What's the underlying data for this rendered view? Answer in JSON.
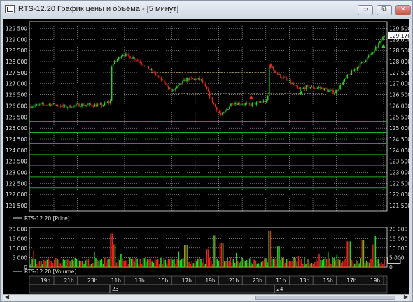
{
  "window": {
    "title": "RTS-12.20 График цены и объёма - [5 минут]",
    "controls": {
      "minimize": "▭",
      "restore": "⧉",
      "close": "✕"
    },
    "icon": "chart-window-icon"
  },
  "colors": {
    "background": "#000000",
    "grid": "#ffffff",
    "candle_up": "#1fd81f",
    "candle_down": "#e8231f",
    "level_line": "#22b022",
    "level_line_dashed": "#c41e1e",
    "price_label_bg": "#ffffff"
  },
  "chart_data": [
    {
      "type": "candlestick",
      "legend": "RTS-12.20 [Price]",
      "current_price_label": "129 170",
      "y_ticks": [
        "129 500",
        "129 000",
        "128 500",
        "128 000",
        "127 500",
        "127 000",
        "126 500",
        "126 000",
        "125 500",
        "125 000",
        "124 500",
        "124 000",
        "123 500",
        "123 000",
        "122 500",
        "122 000",
        "121 500"
      ],
      "ylim": [
        121250,
        129800
      ],
      "close_path": [
        [
          0,
          126000
        ],
        [
          0.06,
          126080
        ],
        [
          0.1,
          125950
        ],
        [
          0.14,
          126050
        ],
        [
          0.2,
          126020
        ],
        [
          0.225,
          126200
        ],
        [
          0.228,
          127800
        ],
        [
          0.26,
          128350
        ],
        [
          0.3,
          128100
        ],
        [
          0.34,
          127600
        ],
        [
          0.38,
          127000
        ],
        [
          0.4,
          126650
        ],
        [
          0.44,
          127200
        ],
        [
          0.48,
          127200
        ],
        [
          0.5,
          126650
        ],
        [
          0.52,
          126000
        ],
        [
          0.54,
          125550
        ],
        [
          0.57,
          126150
        ],
        [
          0.62,
          126050
        ],
        [
          0.66,
          126200
        ],
        [
          0.67,
          126200
        ],
        [
          0.675,
          127850
        ],
        [
          0.7,
          127400
        ],
        [
          0.73,
          127100
        ],
        [
          0.76,
          126700
        ],
        [
          0.78,
          126850
        ],
        [
          0.82,
          126800
        ],
        [
          0.86,
          126600
        ],
        [
          0.9,
          127400
        ],
        [
          0.94,
          128000
        ],
        [
          0.97,
          128450
        ],
        [
          1.0,
          129170
        ]
      ],
      "level_lines": [
        125300,
        124800,
        124300,
        123800,
        123300,
        122800,
        122300
      ],
      "dashed_level": 123500,
      "resistance_dotted": [
        {
          "from": 0.34,
          "to": 0.66,
          "value": 127500
        },
        {
          "from": 0.4,
          "to": 0.82,
          "value": 126550
        }
      ]
    },
    {
      "type": "bar",
      "legend": "RTS-12.20 [Volume]",
      "y_ticks": [
        "20 000",
        "15 000",
        "10 000",
        "5 000",
        "0"
      ],
      "ylim": [
        0,
        21000
      ],
      "spikes": [
        {
          "pos": 0.228,
          "value": 17500
        },
        {
          "pos": 0.236,
          "value": 12000
        },
        {
          "pos": 0.44,
          "value": 11500
        },
        {
          "pos": 0.5,
          "value": 9500
        },
        {
          "pos": 0.52,
          "value": 16800
        },
        {
          "pos": 0.54,
          "value": 12500
        },
        {
          "pos": 0.675,
          "value": 19200
        },
        {
          "pos": 0.7,
          "value": 11000
        },
        {
          "pos": 0.9,
          "value": 13500
        },
        {
          "pos": 0.94,
          "value": 14000
        },
        {
          "pos": 0.97,
          "value": 12000
        }
      ]
    }
  ],
  "time_axis": {
    "hours": [
      "19h",
      "21h",
      "23h",
      "11h",
      "13h",
      "15h",
      "17h",
      "19h",
      "21h",
      "23h",
      "11h",
      "13h",
      "15h",
      "17h",
      "19h"
    ],
    "days": [
      "23",
      "24"
    ]
  }
}
